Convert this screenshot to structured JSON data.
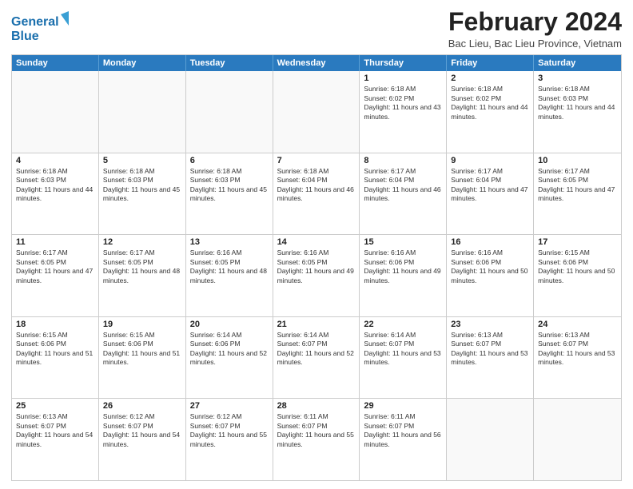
{
  "logo": {
    "line1": "General",
    "line2": "Blue"
  },
  "title": "February 2024",
  "location": "Bac Lieu, Bac Lieu Province, Vietnam",
  "headers": [
    "Sunday",
    "Monday",
    "Tuesday",
    "Wednesday",
    "Thursday",
    "Friday",
    "Saturday"
  ],
  "weeks": [
    [
      {
        "day": "",
        "empty": true
      },
      {
        "day": "",
        "empty": true
      },
      {
        "day": "",
        "empty": true
      },
      {
        "day": "",
        "empty": true
      },
      {
        "day": "1",
        "sunrise": "Sunrise: 6:18 AM",
        "sunset": "Sunset: 6:02 PM",
        "daylight": "Daylight: 11 hours and 43 minutes."
      },
      {
        "day": "2",
        "sunrise": "Sunrise: 6:18 AM",
        "sunset": "Sunset: 6:02 PM",
        "daylight": "Daylight: 11 hours and 44 minutes."
      },
      {
        "day": "3",
        "sunrise": "Sunrise: 6:18 AM",
        "sunset": "Sunset: 6:03 PM",
        "daylight": "Daylight: 11 hours and 44 minutes."
      }
    ],
    [
      {
        "day": "4",
        "sunrise": "Sunrise: 6:18 AM",
        "sunset": "Sunset: 6:03 PM",
        "daylight": "Daylight: 11 hours and 44 minutes."
      },
      {
        "day": "5",
        "sunrise": "Sunrise: 6:18 AM",
        "sunset": "Sunset: 6:03 PM",
        "daylight": "Daylight: 11 hours and 45 minutes."
      },
      {
        "day": "6",
        "sunrise": "Sunrise: 6:18 AM",
        "sunset": "Sunset: 6:03 PM",
        "daylight": "Daylight: 11 hours and 45 minutes."
      },
      {
        "day": "7",
        "sunrise": "Sunrise: 6:18 AM",
        "sunset": "Sunset: 6:04 PM",
        "daylight": "Daylight: 11 hours and 46 minutes."
      },
      {
        "day": "8",
        "sunrise": "Sunrise: 6:17 AM",
        "sunset": "Sunset: 6:04 PM",
        "daylight": "Daylight: 11 hours and 46 minutes."
      },
      {
        "day": "9",
        "sunrise": "Sunrise: 6:17 AM",
        "sunset": "Sunset: 6:04 PM",
        "daylight": "Daylight: 11 hours and 47 minutes."
      },
      {
        "day": "10",
        "sunrise": "Sunrise: 6:17 AM",
        "sunset": "Sunset: 6:05 PM",
        "daylight": "Daylight: 11 hours and 47 minutes."
      }
    ],
    [
      {
        "day": "11",
        "sunrise": "Sunrise: 6:17 AM",
        "sunset": "Sunset: 6:05 PM",
        "daylight": "Daylight: 11 hours and 47 minutes."
      },
      {
        "day": "12",
        "sunrise": "Sunrise: 6:17 AM",
        "sunset": "Sunset: 6:05 PM",
        "daylight": "Daylight: 11 hours and 48 minutes."
      },
      {
        "day": "13",
        "sunrise": "Sunrise: 6:16 AM",
        "sunset": "Sunset: 6:05 PM",
        "daylight": "Daylight: 11 hours and 48 minutes."
      },
      {
        "day": "14",
        "sunrise": "Sunrise: 6:16 AM",
        "sunset": "Sunset: 6:05 PM",
        "daylight": "Daylight: 11 hours and 49 minutes."
      },
      {
        "day": "15",
        "sunrise": "Sunrise: 6:16 AM",
        "sunset": "Sunset: 6:06 PM",
        "daylight": "Daylight: 11 hours and 49 minutes."
      },
      {
        "day": "16",
        "sunrise": "Sunrise: 6:16 AM",
        "sunset": "Sunset: 6:06 PM",
        "daylight": "Daylight: 11 hours and 50 minutes."
      },
      {
        "day": "17",
        "sunrise": "Sunrise: 6:15 AM",
        "sunset": "Sunset: 6:06 PM",
        "daylight": "Daylight: 11 hours and 50 minutes."
      }
    ],
    [
      {
        "day": "18",
        "sunrise": "Sunrise: 6:15 AM",
        "sunset": "Sunset: 6:06 PM",
        "daylight": "Daylight: 11 hours and 51 minutes."
      },
      {
        "day": "19",
        "sunrise": "Sunrise: 6:15 AM",
        "sunset": "Sunset: 6:06 PM",
        "daylight": "Daylight: 11 hours and 51 minutes."
      },
      {
        "day": "20",
        "sunrise": "Sunrise: 6:14 AM",
        "sunset": "Sunset: 6:06 PM",
        "daylight": "Daylight: 11 hours and 52 minutes."
      },
      {
        "day": "21",
        "sunrise": "Sunrise: 6:14 AM",
        "sunset": "Sunset: 6:07 PM",
        "daylight": "Daylight: 11 hours and 52 minutes."
      },
      {
        "day": "22",
        "sunrise": "Sunrise: 6:14 AM",
        "sunset": "Sunset: 6:07 PM",
        "daylight": "Daylight: 11 hours and 53 minutes."
      },
      {
        "day": "23",
        "sunrise": "Sunrise: 6:13 AM",
        "sunset": "Sunset: 6:07 PM",
        "daylight": "Daylight: 11 hours and 53 minutes."
      },
      {
        "day": "24",
        "sunrise": "Sunrise: 6:13 AM",
        "sunset": "Sunset: 6:07 PM",
        "daylight": "Daylight: 11 hours and 53 minutes."
      }
    ],
    [
      {
        "day": "25",
        "sunrise": "Sunrise: 6:13 AM",
        "sunset": "Sunset: 6:07 PM",
        "daylight": "Daylight: 11 hours and 54 minutes."
      },
      {
        "day": "26",
        "sunrise": "Sunrise: 6:12 AM",
        "sunset": "Sunset: 6:07 PM",
        "daylight": "Daylight: 11 hours and 54 minutes."
      },
      {
        "day": "27",
        "sunrise": "Sunrise: 6:12 AM",
        "sunset": "Sunset: 6:07 PM",
        "daylight": "Daylight: 11 hours and 55 minutes."
      },
      {
        "day": "28",
        "sunrise": "Sunrise: 6:11 AM",
        "sunset": "Sunset: 6:07 PM",
        "daylight": "Daylight: 11 hours and 55 minutes."
      },
      {
        "day": "29",
        "sunrise": "Sunrise: 6:11 AM",
        "sunset": "Sunset: 6:07 PM",
        "daylight": "Daylight: 11 hours and 56 minutes."
      },
      {
        "day": "",
        "empty": true
      },
      {
        "day": "",
        "empty": true
      }
    ]
  ]
}
